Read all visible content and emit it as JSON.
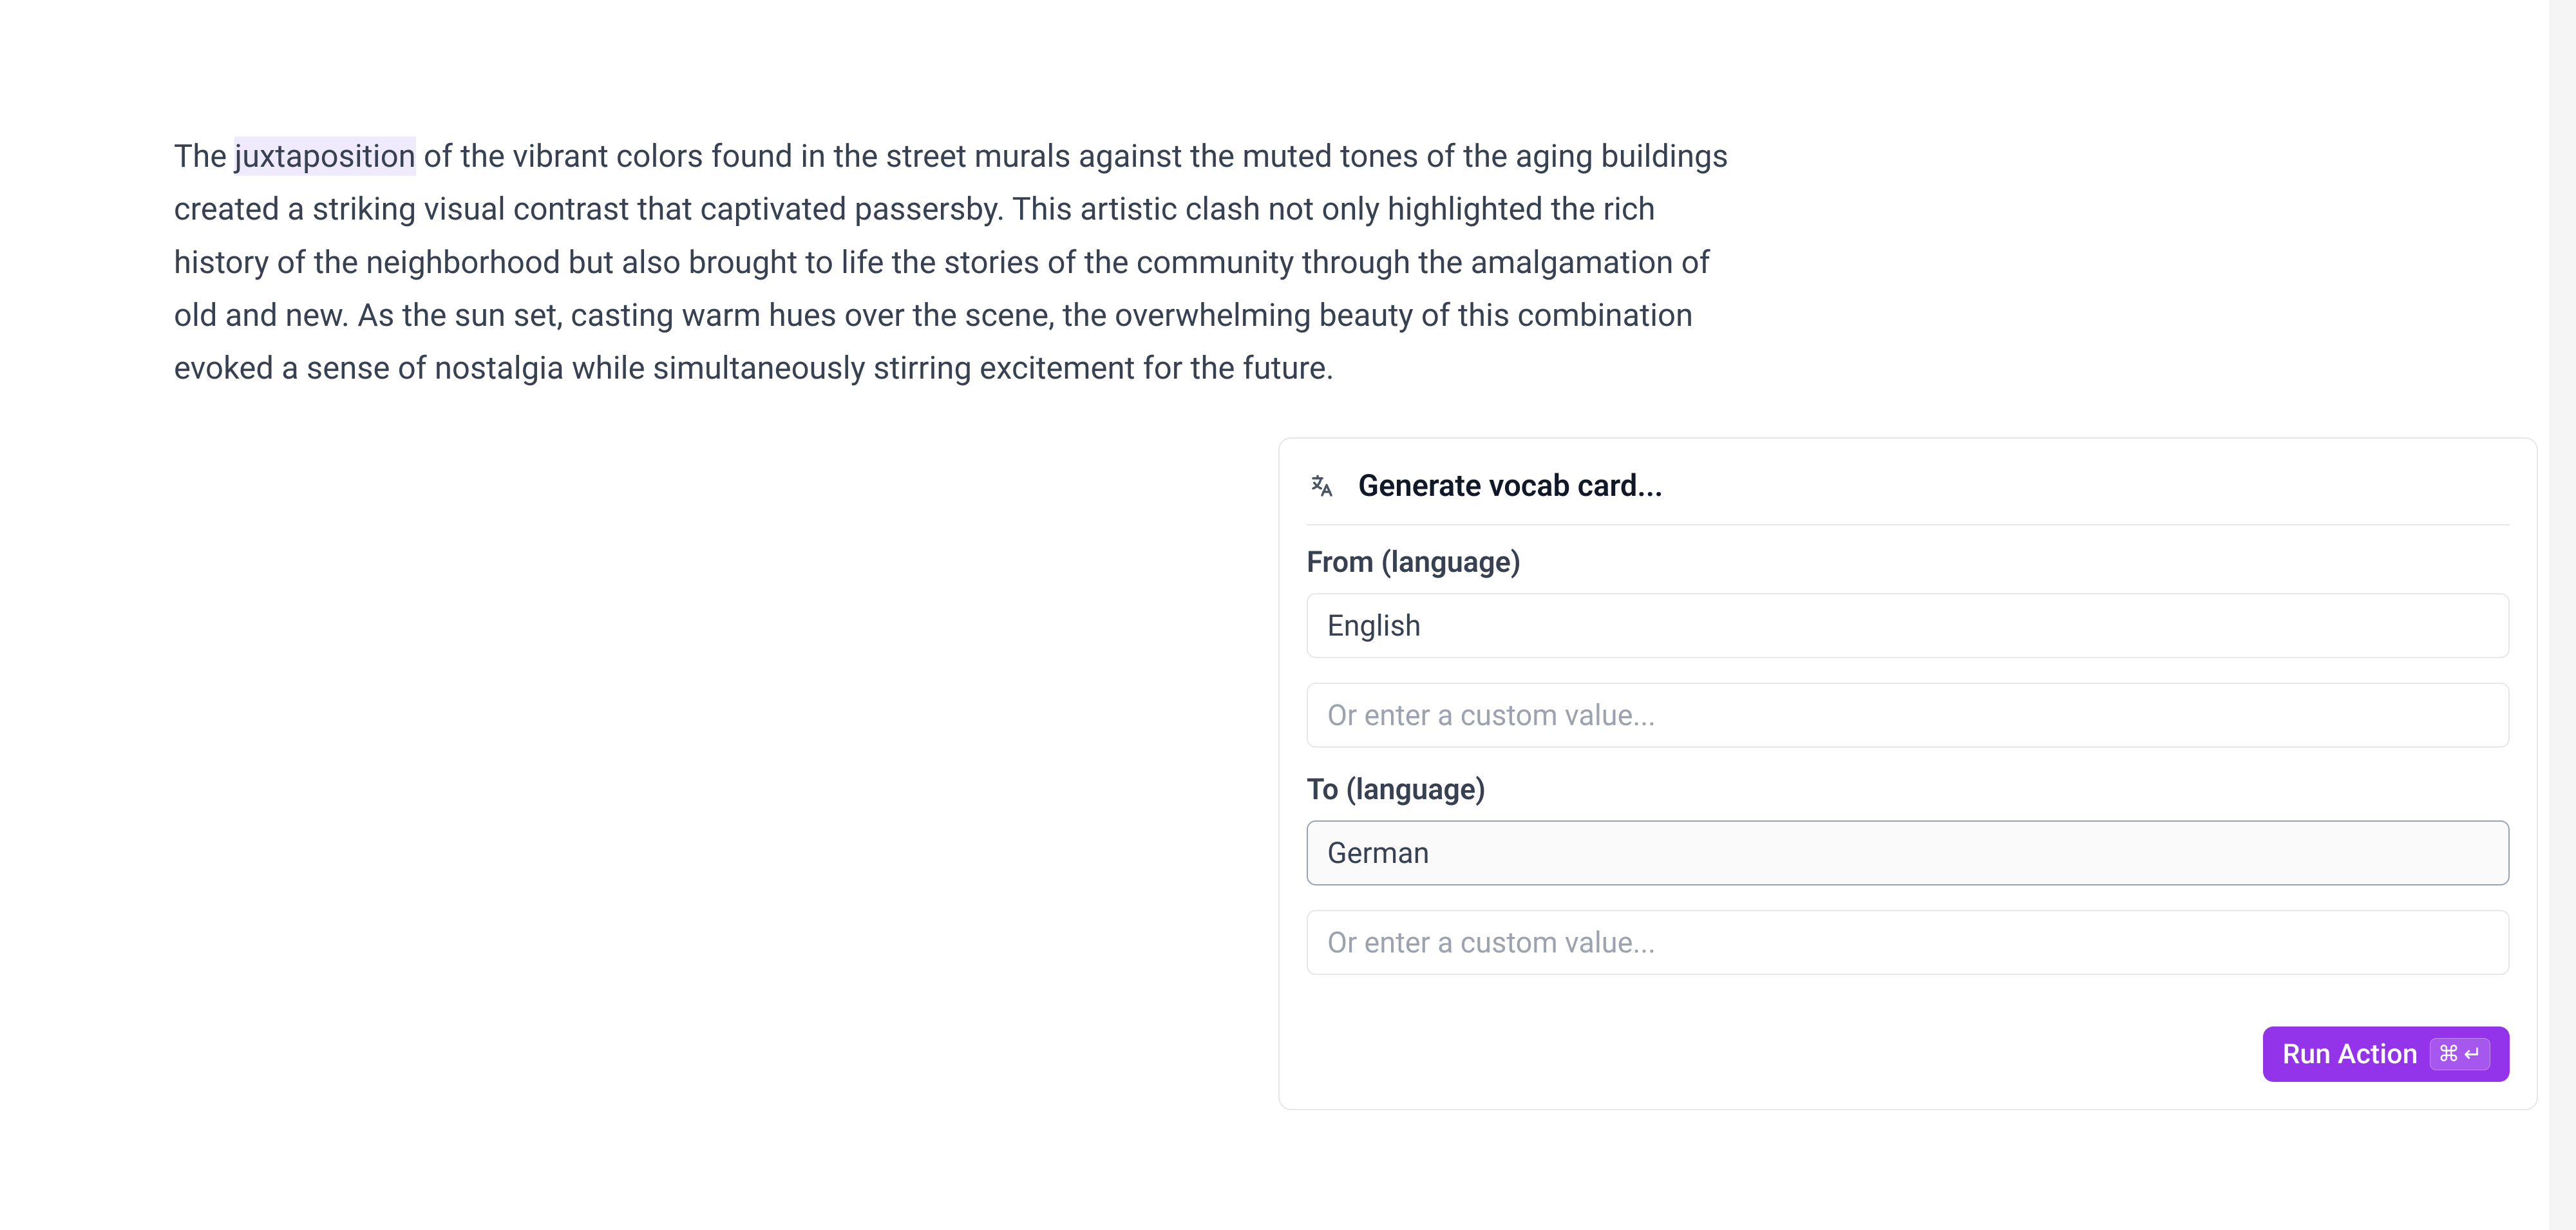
{
  "document": {
    "text_before_highlight": "The ",
    "highlighted_word": "juxtaposition",
    "text_after_highlight": " of the vibrant colors found in the street murals against the muted tones of the aging buildings created a striking visual contrast that captivated passersby. This artistic clash not only highlighted the rich history of the neighborhood but also brought to life the stories of the community through the amalgamation of old and new. As the sun set, casting warm hues over the scene, the overwhelming beauty of this combination evoked a sense of nostalgia while simultaneously stirring excitement for the future."
  },
  "popup": {
    "title": "Generate vocab card...",
    "from_label": "From (language)",
    "from_value": "English",
    "from_custom_placeholder": "Or enter a custom value...",
    "to_label": "To (language)",
    "to_value": "German",
    "to_custom_placeholder": "Or enter a custom value...",
    "run_button_label": "Run Action",
    "shortcut_symbol1": "⌘",
    "shortcut_symbol2": "↵"
  }
}
